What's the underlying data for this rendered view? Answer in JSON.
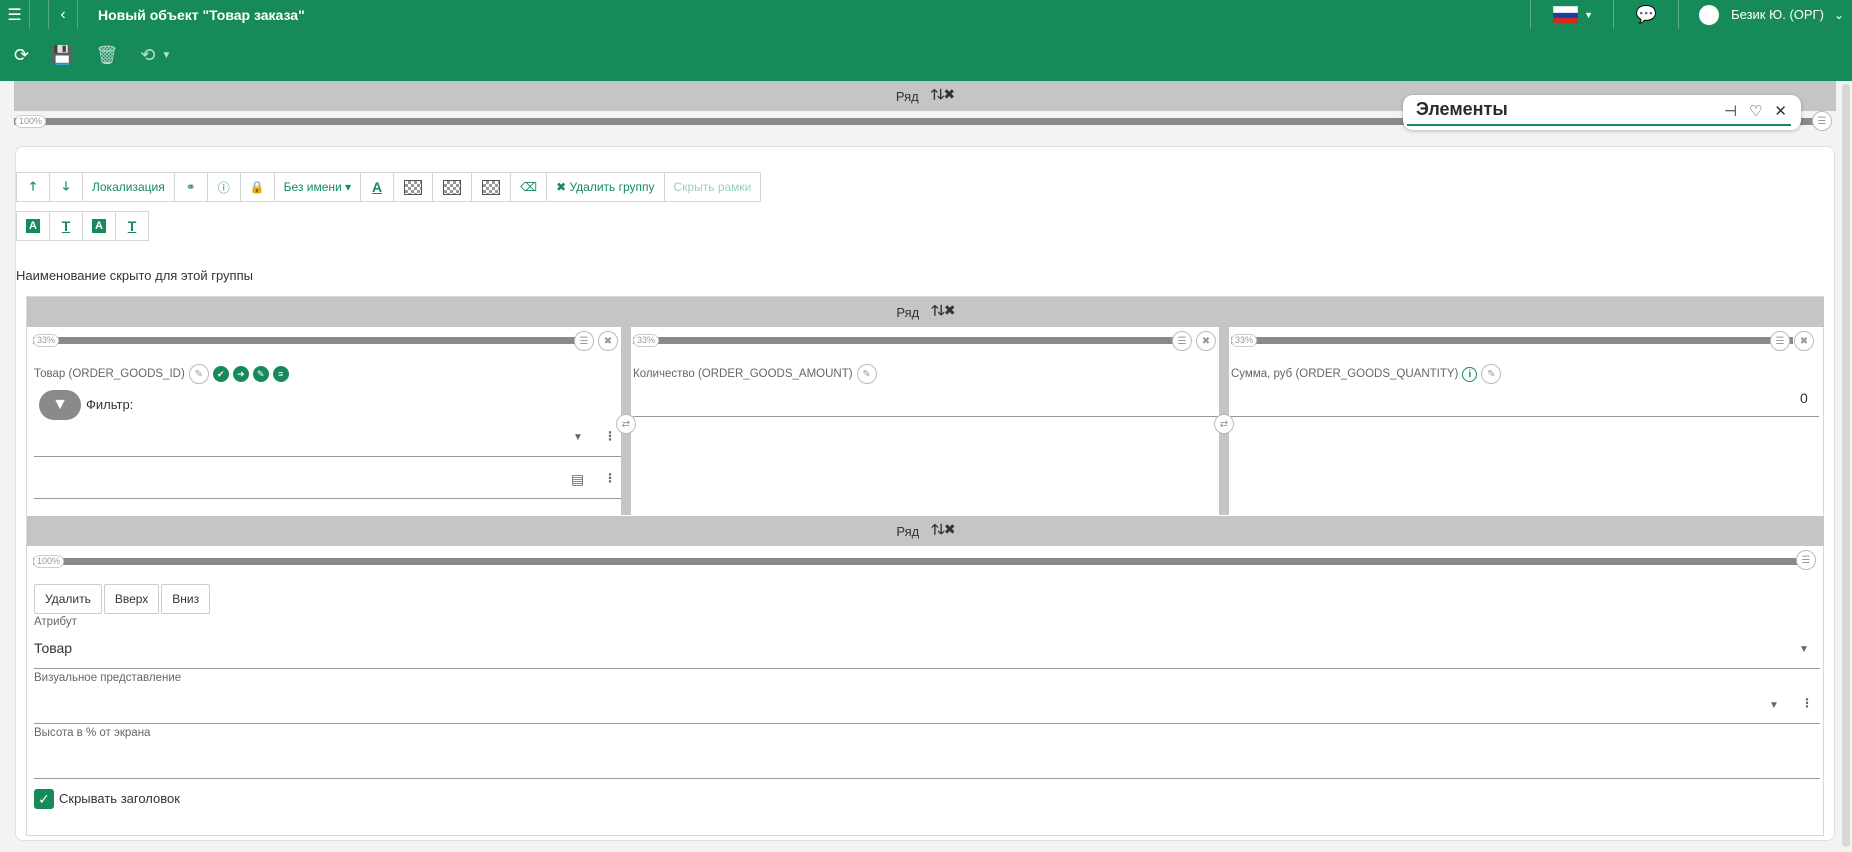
{
  "header": {
    "title": "Новый объект \"Товар заказа\"",
    "user": "Безик Ю. (ОРГ)"
  },
  "outer_row": {
    "label": "Ряд",
    "arrows": "🡑🡓✖",
    "width_pct": "100%"
  },
  "elements_panel": {
    "title": "Элементы"
  },
  "group_toolbar": {
    "localization": "Локализация",
    "no_name": "Без имени",
    "delete_group": "Удалить группу",
    "hide_frames": "Скрыть рамки"
  },
  "hidden_note": "Наименование скрыто для этой группы",
  "inner_row": {
    "label": "Ряд",
    "arrows": "🡑🡓✖",
    "columns": [
      {
        "pct": "33%",
        "label": "Товар (ORDER_GOODS_ID)",
        "filter_label": "Фильтр:"
      },
      {
        "pct": "33%",
        "label": "Количество (ORDER_GOODS_AMOUNT)"
      },
      {
        "pct": "33%",
        "label": "Сумма, руб (ORDER_GOODS_QUANTITY)",
        "value": "0"
      }
    ]
  },
  "settings_row": {
    "label": "Ряд",
    "arrows": "🡑🡓✖",
    "pct": "100%",
    "buttons": {
      "delete": "Удалить",
      "up": "Вверх",
      "down": "Вниз"
    },
    "attribute_label": "Атрибут",
    "attribute_value": "Товар",
    "visual_label": "Визуальное представление",
    "height_label": "Высота в % от экрана",
    "hide_header_label": "Скрывать заголовок"
  },
  "colors": {
    "brand": "#178a5a",
    "row_bg": "#c5c5c5"
  }
}
